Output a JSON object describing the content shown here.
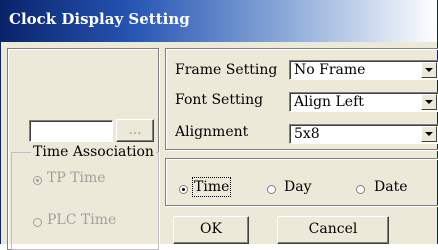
{
  "window": {
    "title": "Clock Display Setting"
  },
  "left_panel": {
    "text_value": "",
    "browse_button": "...",
    "time_association": {
      "legend": "Time Association",
      "options": [
        {
          "label": "TP Time",
          "checked": true,
          "disabled": true
        },
        {
          "label": "PLC Time",
          "checked": false,
          "disabled": true
        }
      ]
    }
  },
  "settings": {
    "frame_label": "Frame Setting",
    "frame_value": "No Frame",
    "font_label": "Font Setting",
    "font_value": "Align Left",
    "alignment_label": "Alignment",
    "alignment_value": "5x8"
  },
  "display_mode": {
    "options": [
      {
        "label": "Time",
        "checked": true
      },
      {
        "label": "Day",
        "checked": false
      },
      {
        "label": "Date",
        "checked": false
      }
    ]
  },
  "buttons": {
    "ok": "OK",
    "cancel": "Cancel"
  }
}
